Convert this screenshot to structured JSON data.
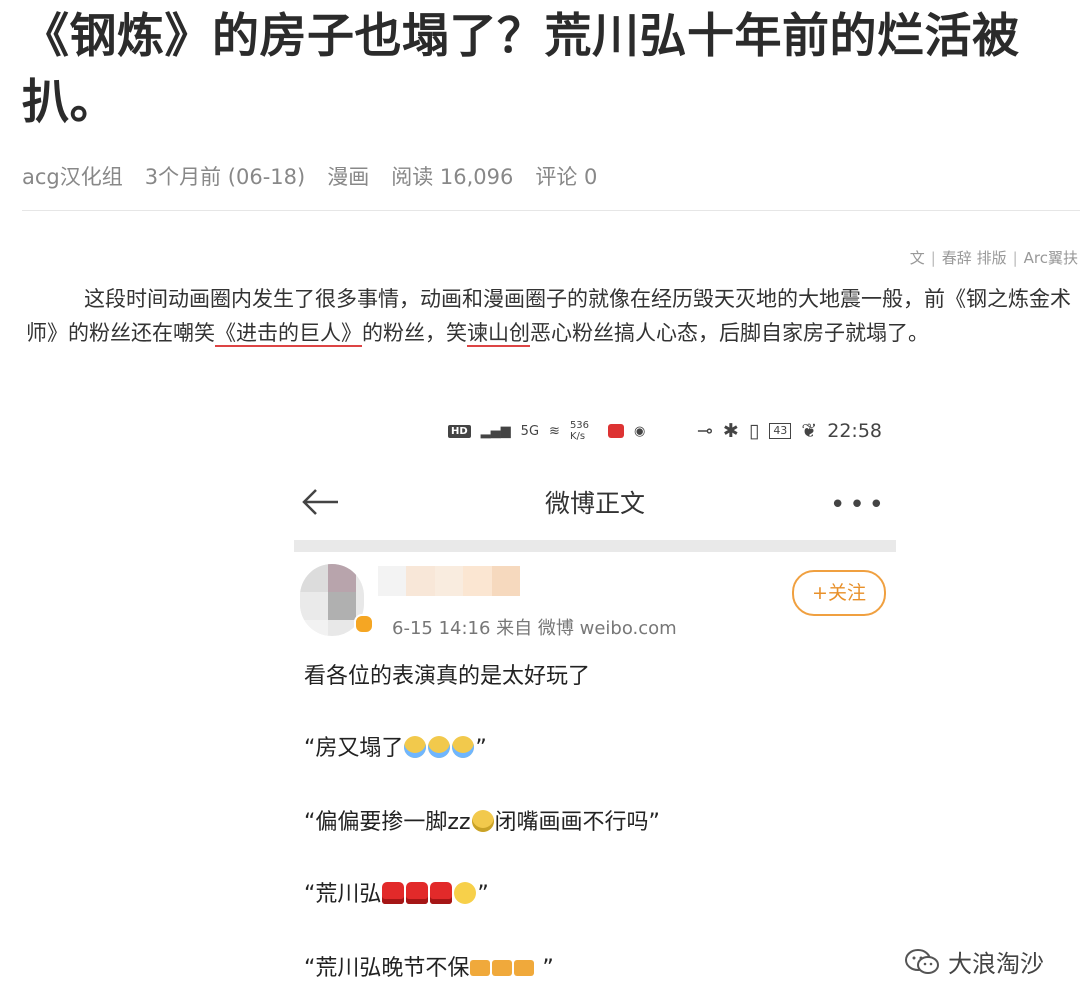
{
  "article": {
    "title": "《钢炼》的房子也塌了？荒川弘十年前的烂活被扒。",
    "meta": {
      "author": "acg汉化组",
      "time": "3个月前 (06-18)",
      "category": "漫画",
      "reads": "阅读 16,096",
      "comments": "评论 0"
    },
    "credit": {
      "text": "文",
      "layout": "春辞 排版",
      "arc": "Arc翼扶"
    },
    "paragraph": {
      "part1": "这段时间动画圈内发生了很多事情，动画和漫画圈子的就像在经历毁天灭地的大地震一般，前《钢之炼金术师》的粉丝还在嘲笑",
      "link1": "《进击的巨人》",
      "part2": "的粉丝，笑",
      "link2": "谏山创",
      "part3": "恶心粉丝搞人心态，后脚自家房子就塌了。"
    }
  },
  "phone": {
    "status": {
      "network": "5G",
      "speed": "536 K/s",
      "time": "22:58",
      "battery": "43"
    },
    "nav": {
      "title": "微博正文"
    },
    "post": {
      "time_source": "6-15 14:16  来自 微博 weibo.com",
      "follow_label": "+关注",
      "lines": [
        "看各位的表演真的是太好玩了",
        "“房又塌了",
        "“偏偏要掺一脚zz",
        "闭嘴画画不行吗”",
        "“荒川弘",
        "“荒川弘晚节不保"
      ],
      "line2_end": "”",
      "line4_end": "”",
      "line5_end": " ”"
    }
  },
  "watermark": {
    "text": "大浪淘沙"
  },
  "colors": {
    "follow": "#e8902a",
    "link_underline": "#dd4444"
  }
}
